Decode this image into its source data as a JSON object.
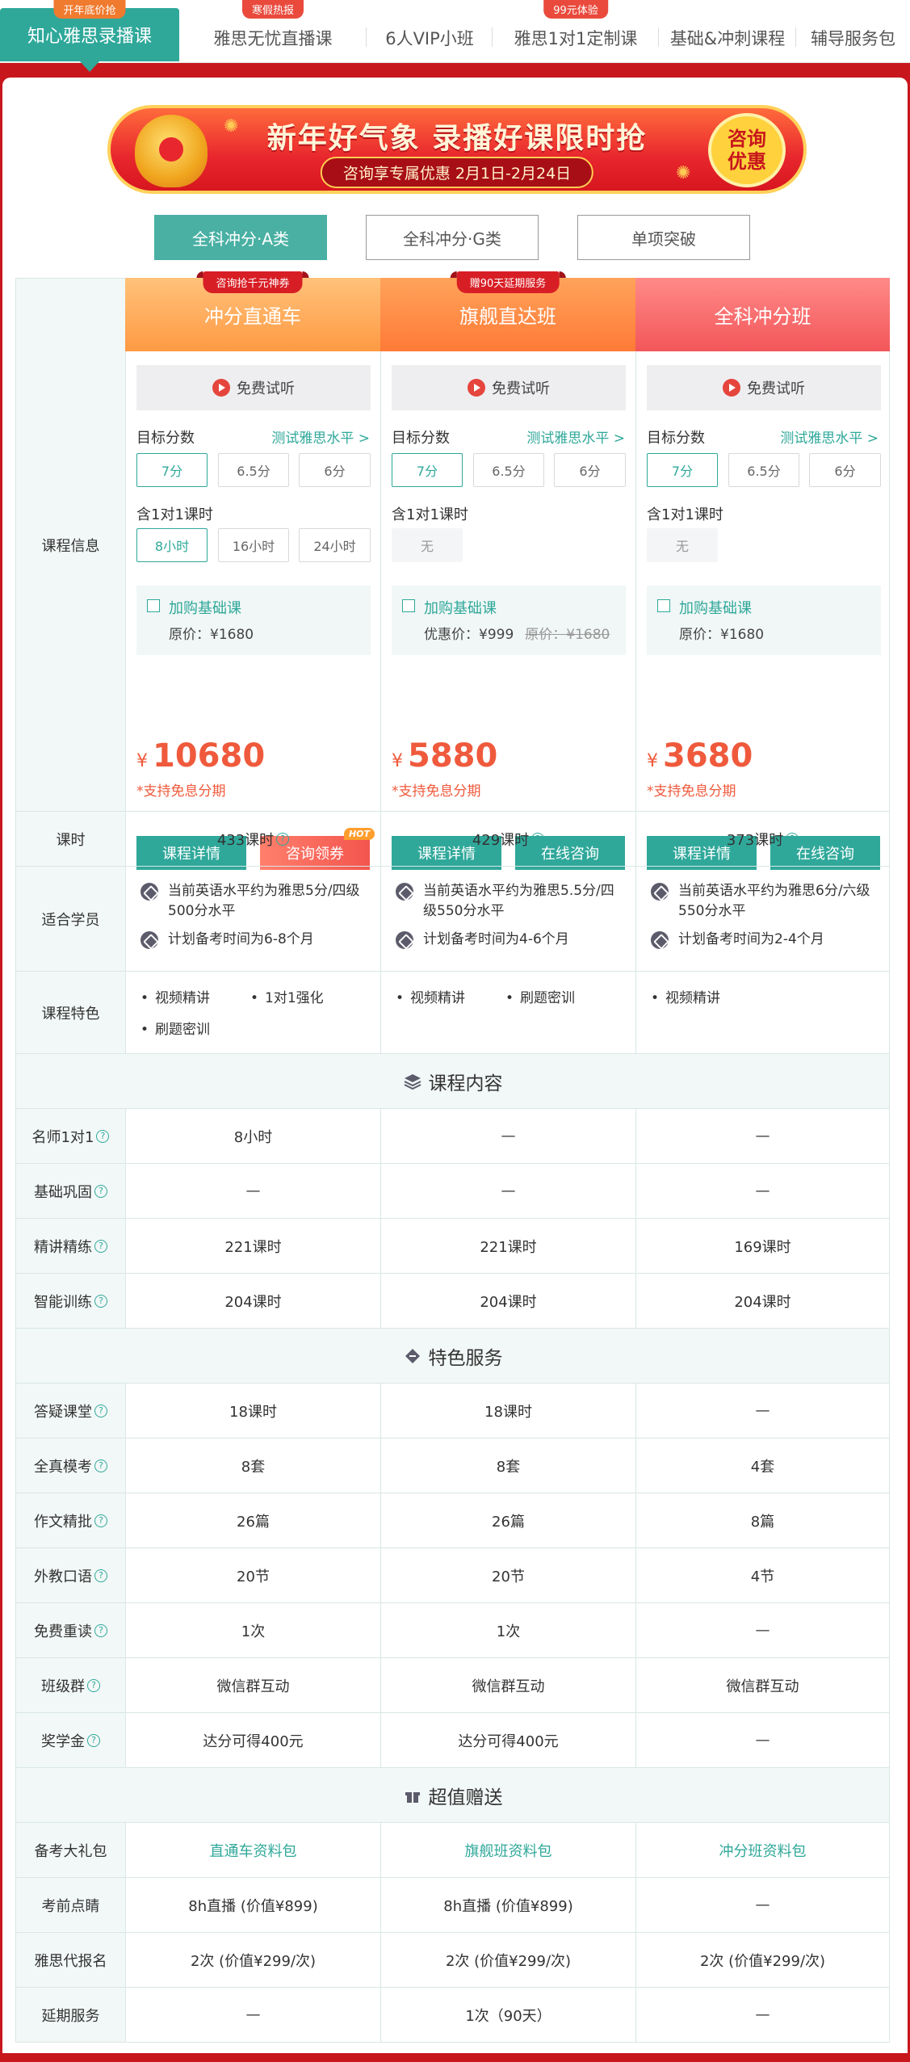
{
  "tabs": [
    {
      "label": "知心雅思录播课",
      "badge": "开年底价抢",
      "active": true
    },
    {
      "label": "雅思无忧直播课",
      "badge": "寒假热报"
    },
    {
      "label": "6人VIP小班",
      "badge": ""
    },
    {
      "label": "雅思1对1定制课",
      "badge": "99元体验"
    },
    {
      "label": "基础&冲刺课程",
      "badge": ""
    },
    {
      "label": "辅导服务包",
      "badge": ""
    }
  ],
  "banner": {
    "title": "新年好气象 录播好课限时抢",
    "subtitle": "咨询享专属优惠  2月1日-2月24日",
    "seal": "咨询优惠"
  },
  "categories": [
    "全科冲分·A类",
    "全科冲分·G类",
    "单项突破"
  ],
  "labels": {
    "course_info": "课程信息",
    "trial": "免费试听",
    "target_score": "目标分数",
    "test_level": "测试雅思水平 >",
    "one_on_one": "含1对1课时",
    "add_basic": "加购基础课",
    "installment": "*支持免息分期",
    "yen": "¥",
    "details_btn": "课程详情",
    "hot": "HOT"
  },
  "courses": [
    {
      "name": "冲分直通车",
      "ribbon": "咨询抢千元神券",
      "scores": [
        "7分",
        "6.5分",
        "6分"
      ],
      "hours_opts": [
        "8小时",
        "16小时",
        "24小时"
      ],
      "basic_price": "原价：¥1680",
      "basic_strike": "",
      "price": "10680",
      "action_btn": "咨询领券"
    },
    {
      "name": "旗舰直达班",
      "ribbon": "赠90天延期服务",
      "scores": [
        "7分",
        "6.5分",
        "6分"
      ],
      "hours_opts": [
        "无"
      ],
      "basic_price": "优惠价：¥999",
      "basic_strike": "原价：¥1680",
      "price": "5880",
      "action_btn": "在线咨询"
    },
    {
      "name": "全科冲分班",
      "ribbon": "",
      "scores": [
        "7分",
        "6.5分",
        "6分"
      ],
      "hours_opts": [
        "无"
      ],
      "basic_price": "原价：¥1680",
      "basic_strike": "",
      "price": "3680",
      "action_btn": "在线咨询"
    }
  ],
  "rows_top": {
    "hours": {
      "label": "课时",
      "values": [
        "433课时",
        "429课时",
        "373课时"
      ]
    },
    "fit": {
      "label": "适合学员",
      "values": [
        [
          "当前英语水平约为雅思5分/四级500分水平",
          "计划备考时间为6-8个月"
        ],
        [
          "当前英语水平约为雅思5.5分/四级550分水平",
          "计划备考时间为4-6个月"
        ],
        [
          "当前英语水平约为雅思6分/六级550分水平",
          "计划备考时间为2-4个月"
        ]
      ]
    },
    "features": {
      "label": "课程特色",
      "values": [
        [
          "视频精讲",
          "1对1强化",
          "刷题密训"
        ],
        [
          "视频精讲",
          "刷题密训"
        ],
        [
          "视频精讲"
        ]
      ]
    }
  },
  "sections": [
    {
      "title": "课程内容",
      "rows": [
        {
          "label": "名师1对1",
          "values": [
            "8小时",
            "—",
            "—"
          ]
        },
        {
          "label": "基础巩固",
          "values": [
            "—",
            "—",
            "—"
          ]
        },
        {
          "label": "精讲精练",
          "values": [
            "221课时",
            "221课时",
            "169课时"
          ]
        },
        {
          "label": "智能训练",
          "values": [
            "204课时",
            "204课时",
            "204课时"
          ]
        }
      ]
    },
    {
      "title": "特色服务",
      "rows": [
        {
          "label": "答疑课堂",
          "values": [
            "18课时",
            "18课时",
            "—"
          ]
        },
        {
          "label": "全真模考",
          "values": [
            "8套",
            "8套",
            "4套"
          ]
        },
        {
          "label": "作文精批",
          "values": [
            "26篇",
            "26篇",
            "8篇"
          ]
        },
        {
          "label": "外教口语",
          "values": [
            "20节",
            "20节",
            "4节"
          ]
        },
        {
          "label": "免费重读",
          "values": [
            "1次",
            "1次",
            "—"
          ]
        },
        {
          "label": "班级群",
          "values": [
            "微信群互动",
            "微信群互动",
            "微信群互动"
          ]
        },
        {
          "label": "奖学金",
          "values": [
            "达分可得400元",
            "达分可得400元",
            "—"
          ]
        }
      ]
    },
    {
      "title": "超值赠送",
      "rows": [
        {
          "label": "备考大礼包",
          "values": [
            "直通车资料包",
            "旗舰班资料包",
            "冲分班资料包"
          ],
          "link": true,
          "noq": true
        },
        {
          "label": "考前点睛",
          "values": [
            "8h直播 (价值¥899)",
            "8h直播 (价值¥899)",
            "—"
          ],
          "noq": true
        },
        {
          "label": "雅思代报名",
          "values": [
            "2次 (价值¥299/次)",
            "2次 (价值¥299/次)",
            "2次 (价值¥299/次)"
          ],
          "noq": true
        },
        {
          "label": "延期服务",
          "values": [
            "—",
            "1次（90天）",
            "—"
          ],
          "noq": true
        }
      ]
    }
  ],
  "colors": {
    "teal": "#2fa89a",
    "red": "#c8161d",
    "price": "#ef5a3c"
  }
}
